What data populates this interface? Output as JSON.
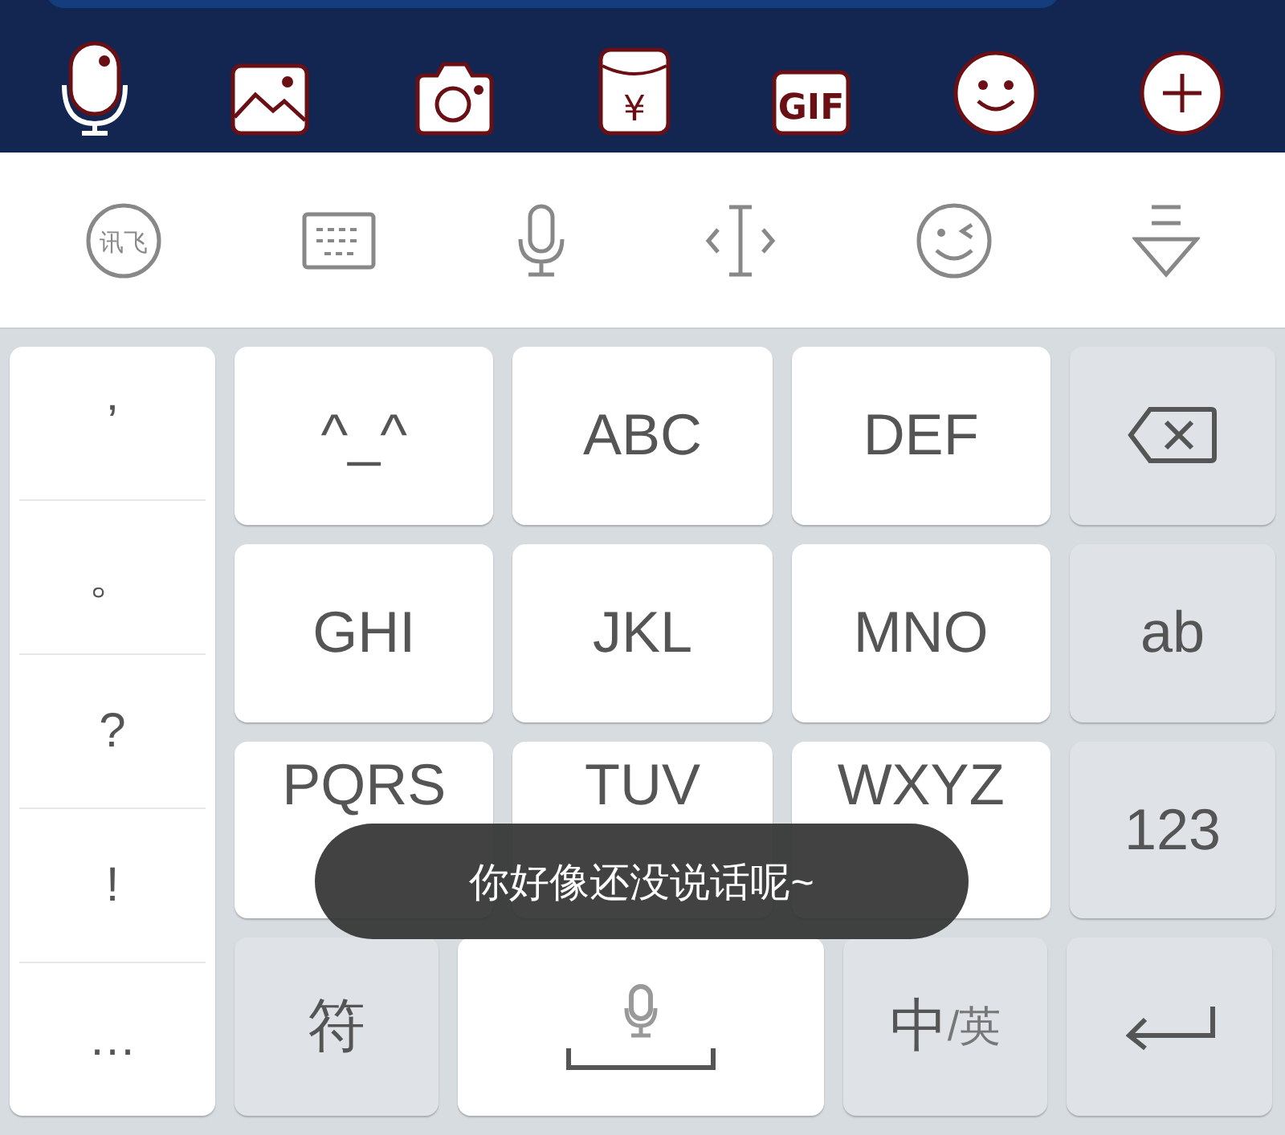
{
  "app_bar": {
    "icons": [
      {
        "kind": "mic"
      },
      {
        "kind": "image"
      },
      {
        "kind": "camera"
      },
      {
        "kind": "red_packet",
        "text": "¥"
      },
      {
        "kind": "gif",
        "text": "GIF"
      },
      {
        "kind": "smile"
      },
      {
        "kind": "plus"
      }
    ]
  },
  "toolbar": [
    {
      "kind": "logo",
      "text": "讯飞"
    },
    {
      "kind": "keyboard"
    },
    {
      "kind": "mic"
    },
    {
      "kind": "cursor"
    },
    {
      "kind": "wink"
    },
    {
      "kind": "collapse"
    }
  ],
  "punctuation": [
    "’",
    "。",
    "?",
    "!",
    "…"
  ],
  "rows": [
    [
      {
        "kind": "letter",
        "label": "^_^"
      },
      {
        "kind": "letter",
        "label": "ABC"
      },
      {
        "kind": "letter",
        "label": "DEF"
      },
      {
        "kind": "backspace"
      }
    ],
    [
      {
        "kind": "letter",
        "label": "GHI"
      },
      {
        "kind": "letter",
        "label": "JKL"
      },
      {
        "kind": "letter",
        "label": "MNO"
      },
      {
        "kind": "function",
        "label": "ab"
      }
    ],
    [
      {
        "kind": "letter",
        "label": "PQRS"
      },
      {
        "kind": "letter",
        "label": "TUV"
      },
      {
        "kind": "letter",
        "label": "WXYZ"
      },
      {
        "kind": "function",
        "label": "123"
      }
    ]
  ],
  "bottom_row": [
    {
      "kind": "function",
      "label": "符"
    },
    {
      "kind": "space"
    },
    {
      "kind": "lang",
      "primary": "中",
      "secondary": "/英"
    },
    {
      "kind": "enter"
    }
  ],
  "toast": {
    "text": "你好像还没说话呢~"
  }
}
